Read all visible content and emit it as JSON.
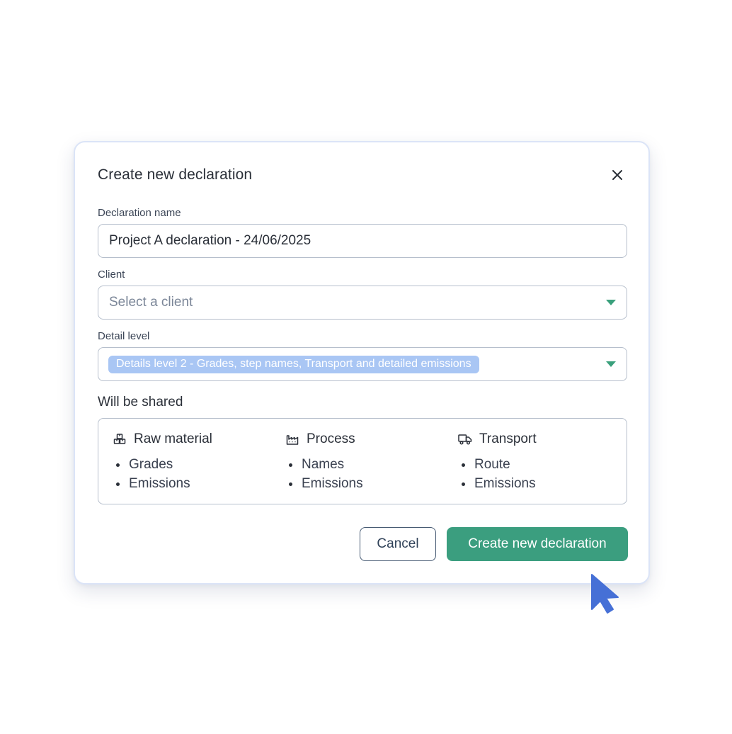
{
  "dialog": {
    "title": "Create new declaration",
    "close_icon": "close-icon"
  },
  "fields": {
    "name": {
      "label": "Declaration name",
      "value": "Project A declaration - 24/06/2025"
    },
    "client": {
      "label": "Client",
      "placeholder": "Select a client"
    },
    "detail_level": {
      "label": "Detail level",
      "selected": "Details level 2 - Grades, step names, Transport and detailed emissions"
    }
  },
  "shared": {
    "title": "Will be shared",
    "columns": [
      {
        "icon": "boxes-icon",
        "heading": "Raw material",
        "items": [
          "Grades",
          "Emissions"
        ]
      },
      {
        "icon": "factory-icon",
        "heading": "Process",
        "items": [
          "Names",
          "Emissions"
        ]
      },
      {
        "icon": "truck-icon",
        "heading": "Transport",
        "items": [
          "Route",
          "Emissions"
        ]
      }
    ]
  },
  "actions": {
    "cancel_label": "Cancel",
    "create_label": "Create new declaration"
  },
  "colors": {
    "primary": "#3b9e7f",
    "chip": "#a9c6f4",
    "cursor": "#4670d6",
    "dialog_border": "#dbe4f7"
  }
}
